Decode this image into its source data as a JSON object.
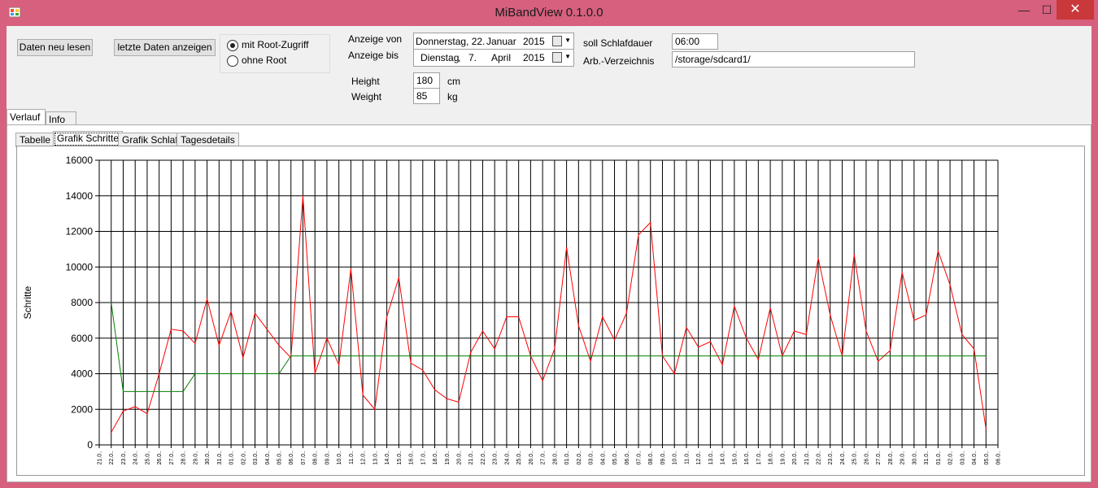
{
  "window": {
    "title": "MiBandView 0.1.0.0",
    "min_glyph": "—",
    "max_glyph": "☐",
    "close_glyph": "✕"
  },
  "toolbar": {
    "reload_label": "Daten neu lesen",
    "show_last_label": "letzte Daten anzeigen"
  },
  "root_options": {
    "with_root_label": "mit Root-Zugriff",
    "without_root_label": "ohne Root",
    "selected": "mit Root-Zugriff"
  },
  "date_range": {
    "from_label": "Anzeige von",
    "to_label": "Anzeige bis",
    "from": {
      "weekday": "Donnerstag, 22.",
      "month": "Januar",
      "year": "2015"
    },
    "to": {
      "weekday": "Dienstag",
      "sep": ",",
      "day": "7.",
      "month": "April",
      "year": "2015"
    }
  },
  "settings": {
    "sleep_label": "soll Schlafdauer",
    "sleep_value": "06:00",
    "dir_label": "Arb.-Verzeichnis",
    "dir_value": "/storage/sdcard1/",
    "height_label": "Height",
    "height_value": "180",
    "height_unit": "cm",
    "weight_label": "Weight",
    "weight_value": "85",
    "weight_unit": "kg"
  },
  "outer_tabs": [
    {
      "label": "Verlauf",
      "active": true
    },
    {
      "label": "Info",
      "active": false
    }
  ],
  "inner_tabs": [
    {
      "label": "Tabelle",
      "active": false
    },
    {
      "label": "Grafik Schritte",
      "active": true
    },
    {
      "label": "Grafik Schlaf",
      "active": false
    },
    {
      "label": "Tagesdetails",
      "active": false
    }
  ],
  "colors": {
    "steps_line": "#ff0000",
    "goal_line": "#008000",
    "grid": "#000000"
  },
  "chart_data": {
    "type": "line",
    "title": "",
    "xlabel": "",
    "ylabel": "Schritte",
    "ylim": [
      0,
      16000
    ],
    "yticks": [
      0,
      2000,
      4000,
      6000,
      8000,
      10000,
      12000,
      14000,
      16000
    ],
    "grid": true,
    "categories": [
      "21.0..",
      "22.0..",
      "23.0..",
      "24.0..",
      "25.0..",
      "26.0..",
      "27.0..",
      "28.0..",
      "29.0..",
      "30.0..",
      "31.0..",
      "01.0..",
      "02.0..",
      "03.0..",
      "04.0..",
      "05.0..",
      "06.0..",
      "07.0..",
      "08.0..",
      "09.0..",
      "10.0..",
      "11.0..",
      "12.0..",
      "13.0..",
      "14.0..",
      "15.0..",
      "16.0..",
      "17.0..",
      "18.0..",
      "19.0..",
      "20.0..",
      "21.0..",
      "22.0..",
      "23.0..",
      "24.0..",
      "25.0..",
      "26.0..",
      "27.0..",
      "28.0..",
      "01.0..",
      "02.0..",
      "03.0..",
      "04.0..",
      "05.0..",
      "06.0..",
      "07.0..",
      "08.0..",
      "09.0..",
      "10.0..",
      "11.0..",
      "12.0..",
      "13.0..",
      "14.0..",
      "15.0..",
      "16.0..",
      "17.0..",
      "18.0..",
      "19.0..",
      "20.0..",
      "21.0..",
      "22.0..",
      "23.0..",
      "24.0..",
      "25.0..",
      "26.0..",
      "27.0..",
      "28.0..",
      "29.0..",
      "30.0..",
      "31.0..",
      "01.0..",
      "02.0..",
      "03.0..",
      "04.0..",
      "05.0..",
      "06.0.."
    ],
    "series": [
      {
        "color": "#ff0000",
        "start_index": 1,
        "values": [
          700,
          1900,
          2150,
          1750,
          4000,
          6500,
          6400,
          5700,
          8200,
          5600,
          7500,
          4900,
          7400,
          6500,
          5600,
          4900,
          14000,
          4000,
          6000,
          4500,
          9900,
          2800,
          2000,
          7200,
          9400,
          4600,
          4200,
          3100,
          2600,
          2400,
          5200,
          6400,
          5400,
          7200,
          7200,
          5000,
          3600,
          5400,
          11100,
          6700,
          4700,
          7200,
          5900,
          7400,
          11800,
          12500,
          5000,
          4000,
          6600,
          5500,
          5800,
          4500,
          7800,
          6000,
          4800,
          7700,
          5000,
          6400,
          6200,
          10500,
          7300,
          5000,
          10700,
          6400,
          4700,
          5300,
          9700,
          7000,
          7300,
          10900,
          9000,
          6200,
          5400,
          900
        ]
      },
      {
        "color": "#008000",
        "start_index": 1,
        "values": [
          8000,
          3000,
          3000,
          3000,
          3000,
          3000,
          3000,
          4000,
          4000,
          4000,
          4000,
          4000,
          4000,
          4000,
          4000,
          5000,
          5000,
          5000,
          5000,
          5000,
          5000,
          5000,
          5000,
          5000,
          5000,
          5000,
          5000,
          5000,
          5000,
          5000,
          5000,
          5000,
          5000,
          5000,
          5000,
          5000,
          5000,
          5000,
          5000,
          5000,
          5000,
          5000,
          5000,
          5000,
          5000,
          5000,
          5000,
          5000,
          5000,
          5000,
          5000,
          5000,
          5000,
          5000,
          5000,
          5000,
          5000,
          5000,
          5000,
          5000,
          5000,
          5000,
          5000,
          5000,
          5000,
          5000,
          5000,
          5000,
          5000,
          5000,
          5000,
          5000,
          5000,
          5000
        ]
      }
    ]
  }
}
